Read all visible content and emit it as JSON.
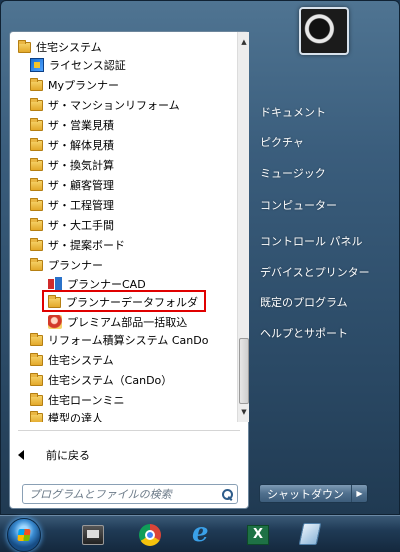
{
  "programs": [
    {
      "label": "住宅システム",
      "icon": "folder",
      "indent": 0
    },
    {
      "label": "ライセンス認証",
      "icon": "license-app",
      "indent": 1
    },
    {
      "label": "Myプランナー",
      "icon": "folder",
      "indent": 1
    },
    {
      "label": "ザ・マンションリフォーム",
      "icon": "folder",
      "indent": 1
    },
    {
      "label": "ザ・営業見積",
      "icon": "folder",
      "indent": 1
    },
    {
      "label": "ザ・解体見積",
      "icon": "folder",
      "indent": 1
    },
    {
      "label": "ザ・換気計算",
      "icon": "folder",
      "indent": 1
    },
    {
      "label": "ザ・顧客管理",
      "icon": "folder",
      "indent": 1
    },
    {
      "label": "ザ・工程管理",
      "icon": "folder",
      "indent": 1
    },
    {
      "label": "ザ・大工手間",
      "icon": "folder",
      "indent": 1
    },
    {
      "label": "ザ・提案ボード",
      "icon": "folder",
      "indent": 1
    },
    {
      "label": "プランナー",
      "icon": "folder",
      "indent": 1
    },
    {
      "label": "プランナーCAD",
      "icon": "cad-app",
      "indent": 2
    },
    {
      "label": "プランナーデータフォルダ",
      "icon": "folder",
      "indent": 2
    },
    {
      "label": "プレミアム部品一括取込",
      "icon": "premium-app",
      "indent": 2
    },
    {
      "label": "リフォーム積算システム CanDo",
      "icon": "folder",
      "indent": 1
    },
    {
      "label": "住宅システム",
      "icon": "folder",
      "indent": 1
    },
    {
      "label": "住宅システム（CanDo）",
      "icon": "folder",
      "indent": 1
    },
    {
      "label": "住宅ローンミニ",
      "icon": "folder",
      "indent": 1
    },
    {
      "label": "模型の達人",
      "icon": "folder",
      "indent": 1
    }
  ],
  "back_label": "前に戻る",
  "search": {
    "placeholder": "プログラムとファイルの検索"
  },
  "right_menu": [
    "ドキュメント",
    "ピクチャ",
    "ミュージック",
    "コンピューター",
    "コントロール パネル",
    "デバイスとプリンター",
    "既定のプログラム",
    "ヘルプとサポート"
  ],
  "shutdown_label": "シャットダウン",
  "taskbar_icons": [
    "start-orb-icon",
    "explorer-icon",
    "chrome-icon",
    "internet-explorer-icon",
    "excel-icon",
    "other-app-icon"
  ],
  "colors": {
    "highlight": "#e00000"
  }
}
